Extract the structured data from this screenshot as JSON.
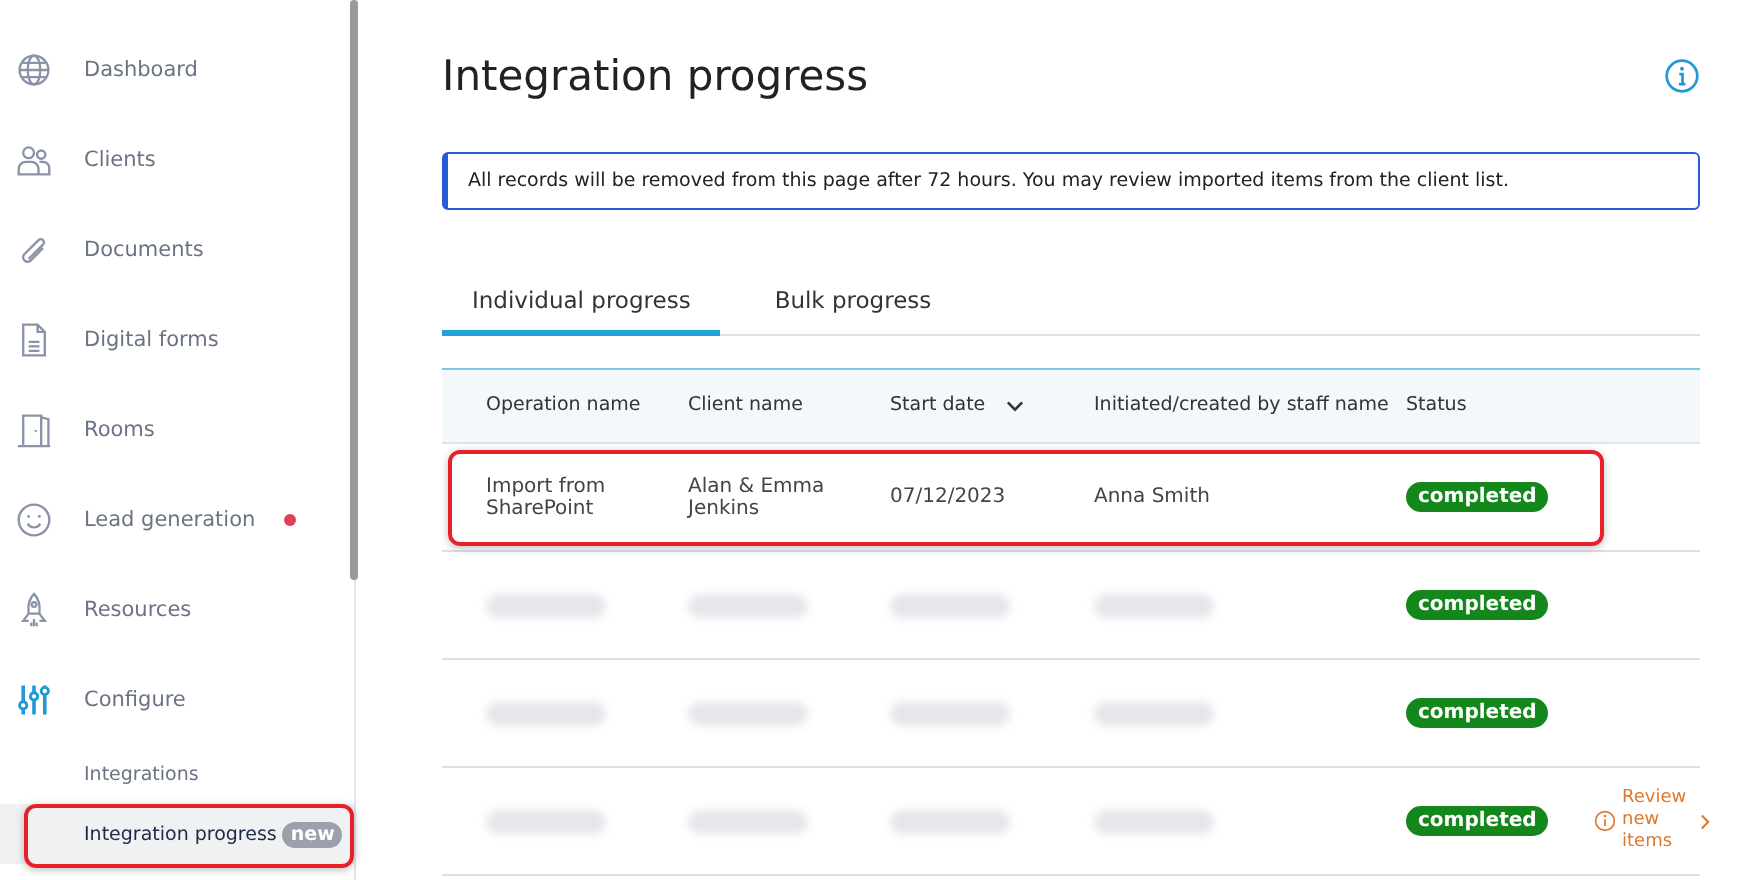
{
  "sidebar": {
    "items": [
      {
        "label": "Dashboard",
        "dot": false
      },
      {
        "label": "Clients",
        "dot": false
      },
      {
        "label": "Documents",
        "dot": false
      },
      {
        "label": "Digital forms",
        "dot": false
      },
      {
        "label": "Rooms",
        "dot": false
      },
      {
        "label": "Lead generation",
        "dot": true
      },
      {
        "label": "Resources",
        "dot": false
      },
      {
        "label": "Configure",
        "dot": false,
        "children": [
          {
            "label": "Integrations",
            "selected": false,
            "highlighted": false
          },
          {
            "label": "Integration progress",
            "selected": true,
            "highlighted": true,
            "badge": "new"
          }
        ]
      }
    ]
  },
  "page": {
    "title": "Integration progress",
    "notice": "All records will be removed from this page after 72 hours. You may review imported items from the client list."
  },
  "tabs": [
    {
      "label": "Individual progress",
      "selected": true
    },
    {
      "label": "Bulk progress",
      "selected": false
    }
  ],
  "table": {
    "columns": [
      {
        "label": "Operation name",
        "sorted": false
      },
      {
        "label": "Client name",
        "sorted": false
      },
      {
        "label": "Start date",
        "sorted": true
      },
      {
        "label": "Initiated/created by staff name",
        "sorted": false
      },
      {
        "label": "Status",
        "sorted": false
      }
    ],
    "rows": [
      {
        "blurred": false,
        "highlighted": true,
        "operation": "Import from SharePoint",
        "client": "Alan & Emma Jenkins",
        "date": "07/12/2023",
        "staff": "Anna Smith",
        "status": "completed"
      },
      {
        "blurred": true,
        "highlighted": false,
        "status": "completed"
      },
      {
        "blurred": true,
        "highlighted": false,
        "status": "completed"
      },
      {
        "blurred": true,
        "highlighted": false,
        "status": "completed",
        "action": "Review new items"
      }
    ]
  }
}
